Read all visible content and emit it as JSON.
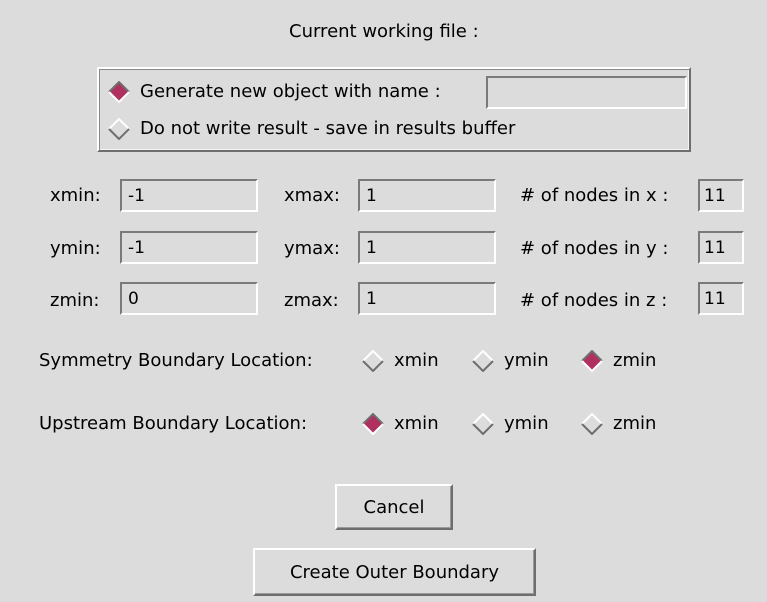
{
  "header": {
    "title": "Current working file :"
  },
  "output_mode": {
    "options": [
      {
        "label": "Generate new object with name :",
        "selected": true
      },
      {
        "label": "Do not write result - save in results buffer",
        "selected": false
      }
    ],
    "object_name": {
      "value": ""
    }
  },
  "bounds": {
    "xmin": {
      "label": "xmin:",
      "value": "-1"
    },
    "xmax": {
      "label": "xmax:",
      "value": "1"
    },
    "ymin": {
      "label": "ymin:",
      "value": "-1"
    },
    "ymax": {
      "label": "ymax:",
      "value": "1"
    },
    "zmin": {
      "label": "zmin:",
      "value": "0"
    },
    "zmax": {
      "label": "zmax:",
      "value": "1"
    },
    "nx": {
      "label": "# of nodes in x :",
      "value": "11"
    },
    "ny": {
      "label": "# of nodes in y :",
      "value": "11"
    },
    "nz": {
      "label": "# of nodes in z :",
      "value": "11"
    }
  },
  "symmetry": {
    "label": "Symmetry Boundary Location:",
    "options": [
      {
        "label": "xmin",
        "selected": false
      },
      {
        "label": "ymin",
        "selected": false
      },
      {
        "label": "zmin",
        "selected": true
      }
    ]
  },
  "upstream": {
    "label": "Upstream Boundary Location:",
    "options": [
      {
        "label": "xmin",
        "selected": true
      },
      {
        "label": "ymin",
        "selected": false
      },
      {
        "label": "zmin",
        "selected": false
      }
    ]
  },
  "buttons": {
    "cancel": "Cancel",
    "create": "Create Outer Boundary"
  },
  "colors": {
    "background": "#dcdcdc",
    "radio_selected": "#b03060",
    "radio_unselected": "#dcdcdc"
  }
}
